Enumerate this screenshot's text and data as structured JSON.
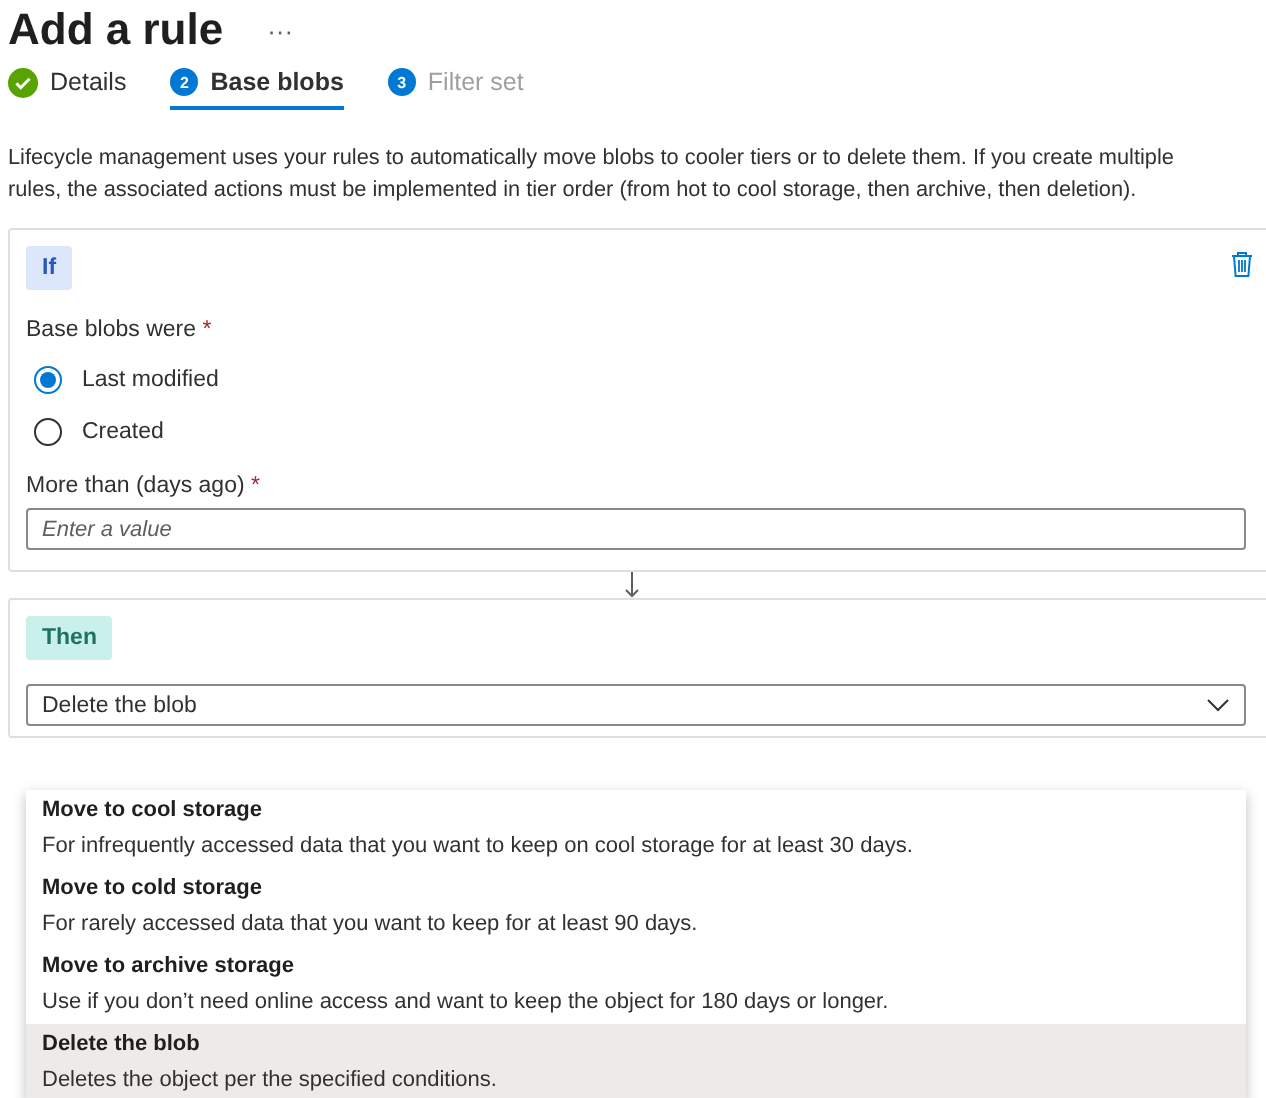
{
  "title": "Add a rule",
  "more": "···",
  "steps": [
    {
      "kind": "done",
      "label": "Details",
      "selected": false
    },
    {
      "kind": "current",
      "number": "2",
      "label": "Base blobs",
      "selected": true
    },
    {
      "kind": "pending",
      "number": "3",
      "label": "Filter set",
      "selected": false
    }
  ],
  "description": "Lifecycle management uses your rules to automatically move blobs to cooler tiers or to delete them. If you create multiple rules, the associated actions must be implemented in tier order (from hot to cool storage, then archive, then deletion).",
  "if_block": {
    "tag": "If",
    "condition_label": "Base blobs were",
    "condition_asterisk": "*",
    "options": [
      {
        "label": "Last modified",
        "selected": true
      },
      {
        "label": "Created",
        "selected": false
      }
    ],
    "days_label": "More than (days ago)",
    "days_asterisk": "*",
    "days_placeholder": "Enter a value"
  },
  "then_block": {
    "tag": "Then",
    "value": "Delete the blob",
    "expanded": true,
    "options": [
      {
        "title": "Move to cool storage",
        "description": "For infrequently accessed data that you want to keep on cool storage for at least 30 days.",
        "selected": false
      },
      {
        "title": "Move to cold storage",
        "description": "For rarely accessed data that you want to keep for at least 90 days.",
        "selected": false
      },
      {
        "title": "Move to archive storage",
        "description": "Use if you don’t need online access and want to keep the object for 180 days or longer.",
        "selected": false
      },
      {
        "title": "Delete the blob",
        "description": "Deletes the object per the specified conditions.",
        "selected": true
      }
    ]
  }
}
